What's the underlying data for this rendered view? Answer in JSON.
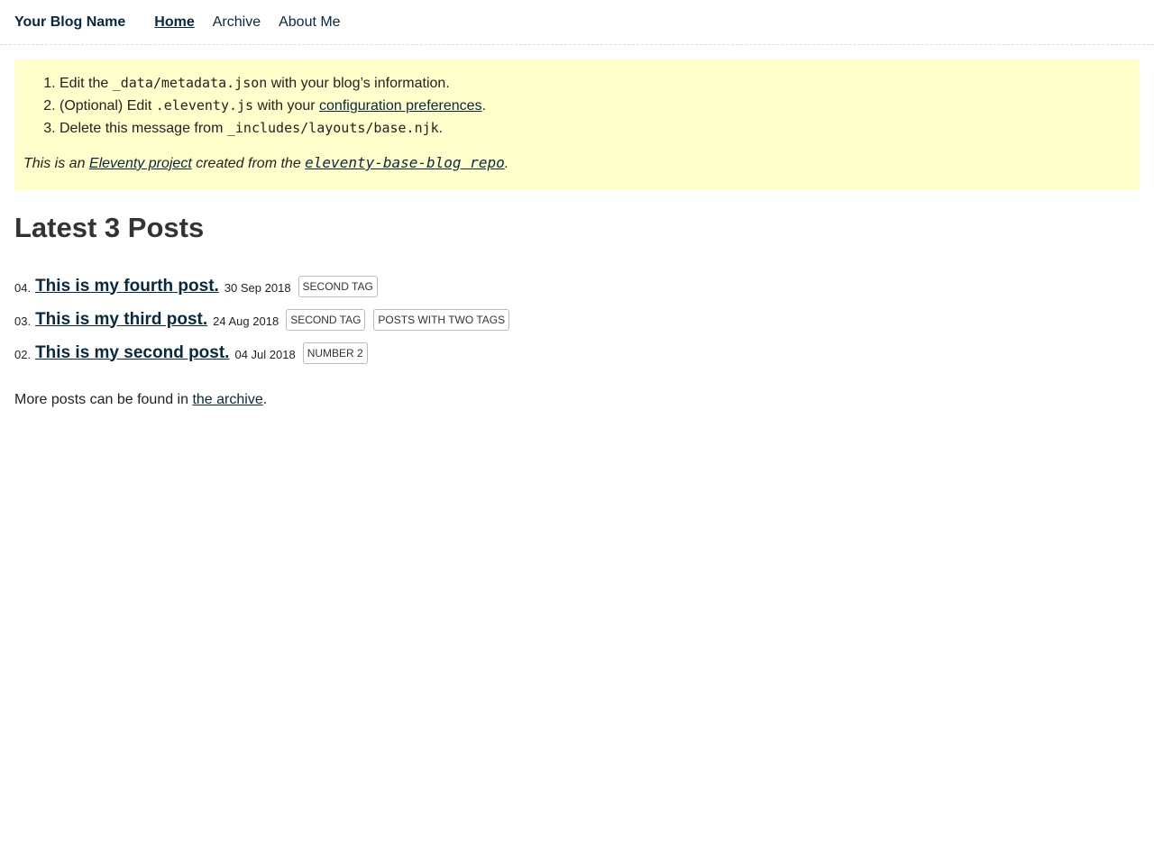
{
  "header": {
    "site_title": "Your Blog Name",
    "nav": [
      {
        "label": "Home"
      },
      {
        "label": "Archive"
      },
      {
        "label": "About Me"
      }
    ]
  },
  "notice": {
    "step1": {
      "num_text": "Edit the ",
      "code": "_data/metadata.json",
      "tail": " with your blog’s information."
    },
    "step2": {
      "prefix": "(Optional) Edit ",
      "code": ".eleventy.js",
      "middle": " with your ",
      "link": "configuration preferences",
      "tail": "."
    },
    "step3": {
      "prefix": "Delete this message from ",
      "code": "_includes/layouts/base.njk",
      "tail": "."
    },
    "note": {
      "prefix": "This is an ",
      "link1": "Eleventy project",
      "middle": " created from the ",
      "link2": "eleventy-base-blog repo",
      "tail": "."
    }
  },
  "main": {
    "heading": "Latest 3 Posts",
    "posts": [
      {
        "num": "04.",
        "title": "This is my fourth post.",
        "date": "30 Sep 2018",
        "tags": [
          "second tag"
        ]
      },
      {
        "num": "03.",
        "title": "This is my third post.",
        "date": "24 Aug 2018",
        "tags": [
          "second tag",
          "posts with two tags"
        ]
      },
      {
        "num": "02.",
        "title": "This is my second post.",
        "date": "04 Jul 2018",
        "tags": [
          "number 2"
        ]
      }
    ],
    "more": {
      "prefix": "More posts can be found in ",
      "link": "the archive",
      "tail": "."
    }
  }
}
